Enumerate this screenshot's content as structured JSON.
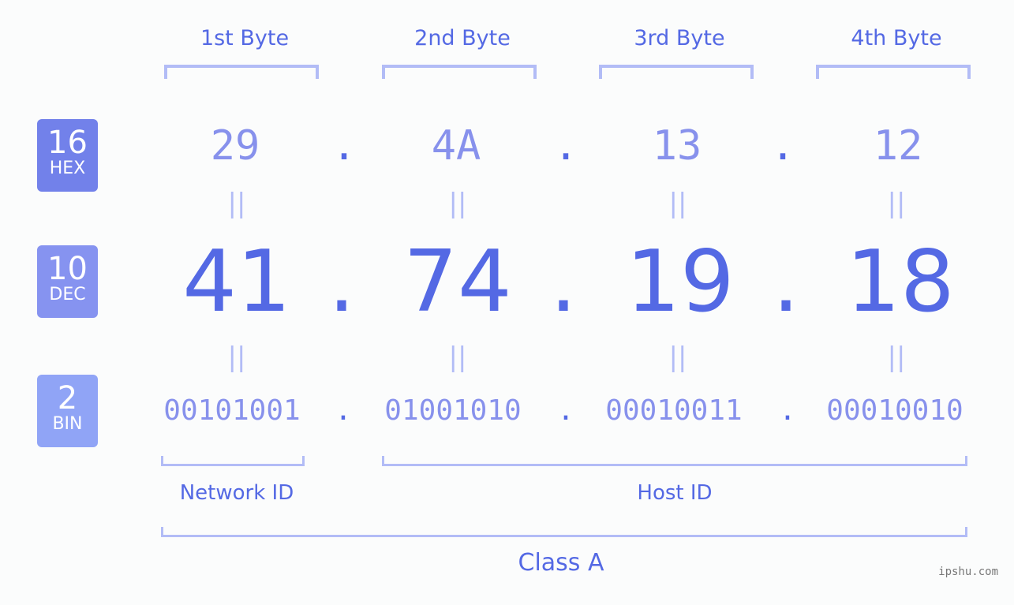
{
  "bytes": [
    {
      "label": "1st Byte",
      "hex": "29",
      "dec": "41",
      "bin": "00101001"
    },
    {
      "label": "2nd Byte",
      "hex": "4A",
      "dec": "74",
      "bin": "01001010"
    },
    {
      "label": "3rd Byte",
      "hex": "13",
      "dec": "19",
      "bin": "00010011"
    },
    {
      "label": "4th Byte",
      "hex": "12",
      "dec": "18",
      "bin": "00010010"
    }
  ],
  "badges": {
    "hex": {
      "num": "16",
      "label": "HEX",
      "color": "#7281ea"
    },
    "dec": {
      "num": "10",
      "label": "DEC",
      "color": "#8693f0"
    },
    "bin": {
      "num": "2",
      "label": "BIN",
      "color": "#90a4f6"
    }
  },
  "separator": ".",
  "equals": "||",
  "network_id": "Network ID",
  "host_id": "Host ID",
  "class_label": "Class A",
  "watermark": "ipshu.com",
  "colors": {
    "accent": "#5469e4",
    "light": "#8791ec",
    "bracket": "#b2bcf6"
  }
}
